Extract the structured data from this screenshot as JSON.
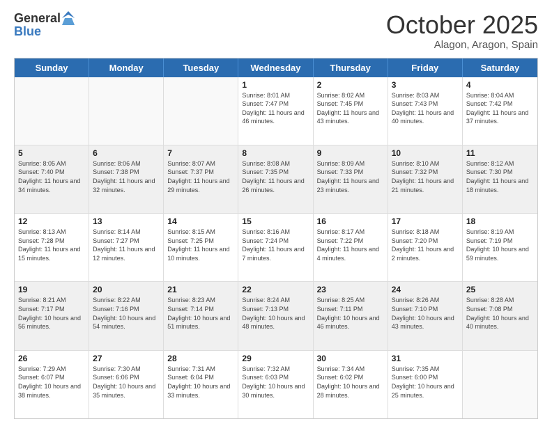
{
  "logo": {
    "general": "General",
    "blue": "Blue"
  },
  "title": "October 2025",
  "subtitle": "Alagon, Aragon, Spain",
  "days": [
    "Sunday",
    "Monday",
    "Tuesday",
    "Wednesday",
    "Thursday",
    "Friday",
    "Saturday"
  ],
  "weeks": [
    [
      {
        "day": "",
        "empty": true
      },
      {
        "day": "",
        "empty": true
      },
      {
        "day": "",
        "empty": true
      },
      {
        "day": "1",
        "rise": "8:01 AM",
        "set": "7:47 PM",
        "daylight": "11 hours and 46 minutes."
      },
      {
        "day": "2",
        "rise": "8:02 AM",
        "set": "7:45 PM",
        "daylight": "11 hours and 43 minutes."
      },
      {
        "day": "3",
        "rise": "8:03 AM",
        "set": "7:43 PM",
        "daylight": "11 hours and 40 minutes."
      },
      {
        "day": "4",
        "rise": "8:04 AM",
        "set": "7:42 PM",
        "daylight": "11 hours and 37 minutes."
      }
    ],
    [
      {
        "day": "5",
        "rise": "8:05 AM",
        "set": "7:40 PM",
        "daylight": "11 hours and 34 minutes."
      },
      {
        "day": "6",
        "rise": "8:06 AM",
        "set": "7:38 PM",
        "daylight": "11 hours and 32 minutes."
      },
      {
        "day": "7",
        "rise": "8:07 AM",
        "set": "7:37 PM",
        "daylight": "11 hours and 29 minutes."
      },
      {
        "day": "8",
        "rise": "8:08 AM",
        "set": "7:35 PM",
        "daylight": "11 hours and 26 minutes."
      },
      {
        "day": "9",
        "rise": "8:09 AM",
        "set": "7:33 PM",
        "daylight": "11 hours and 23 minutes."
      },
      {
        "day": "10",
        "rise": "8:10 AM",
        "set": "7:32 PM",
        "daylight": "11 hours and 21 minutes."
      },
      {
        "day": "11",
        "rise": "8:12 AM",
        "set": "7:30 PM",
        "daylight": "11 hours and 18 minutes."
      }
    ],
    [
      {
        "day": "12",
        "rise": "8:13 AM",
        "set": "7:28 PM",
        "daylight": "11 hours and 15 minutes."
      },
      {
        "day": "13",
        "rise": "8:14 AM",
        "set": "7:27 PM",
        "daylight": "11 hours and 12 minutes."
      },
      {
        "day": "14",
        "rise": "8:15 AM",
        "set": "7:25 PM",
        "daylight": "11 hours and 10 minutes."
      },
      {
        "day": "15",
        "rise": "8:16 AM",
        "set": "7:24 PM",
        "daylight": "11 hours and 7 minutes."
      },
      {
        "day": "16",
        "rise": "8:17 AM",
        "set": "7:22 PM",
        "daylight": "11 hours and 4 minutes."
      },
      {
        "day": "17",
        "rise": "8:18 AM",
        "set": "7:20 PM",
        "daylight": "11 hours and 2 minutes."
      },
      {
        "day": "18",
        "rise": "8:19 AM",
        "set": "7:19 PM",
        "daylight": "10 hours and 59 minutes."
      }
    ],
    [
      {
        "day": "19",
        "rise": "8:21 AM",
        "set": "7:17 PM",
        "daylight": "10 hours and 56 minutes."
      },
      {
        "day": "20",
        "rise": "8:22 AM",
        "set": "7:16 PM",
        "daylight": "10 hours and 54 minutes."
      },
      {
        "day": "21",
        "rise": "8:23 AM",
        "set": "7:14 PM",
        "daylight": "10 hours and 51 minutes."
      },
      {
        "day": "22",
        "rise": "8:24 AM",
        "set": "7:13 PM",
        "daylight": "10 hours and 48 minutes."
      },
      {
        "day": "23",
        "rise": "8:25 AM",
        "set": "7:11 PM",
        "daylight": "10 hours and 46 minutes."
      },
      {
        "day": "24",
        "rise": "8:26 AM",
        "set": "7:10 PM",
        "daylight": "10 hours and 43 minutes."
      },
      {
        "day": "25",
        "rise": "8:28 AM",
        "set": "7:08 PM",
        "daylight": "10 hours and 40 minutes."
      }
    ],
    [
      {
        "day": "26",
        "rise": "7:29 AM",
        "set": "6:07 PM",
        "daylight": "10 hours and 38 minutes."
      },
      {
        "day": "27",
        "rise": "7:30 AM",
        "set": "6:06 PM",
        "daylight": "10 hours and 35 minutes."
      },
      {
        "day": "28",
        "rise": "7:31 AM",
        "set": "6:04 PM",
        "daylight": "10 hours and 33 minutes."
      },
      {
        "day": "29",
        "rise": "7:32 AM",
        "set": "6:03 PM",
        "daylight": "10 hours and 30 minutes."
      },
      {
        "day": "30",
        "rise": "7:34 AM",
        "set": "6:02 PM",
        "daylight": "10 hours and 28 minutes."
      },
      {
        "day": "31",
        "rise": "7:35 AM",
        "set": "6:00 PM",
        "daylight": "10 hours and 25 minutes."
      },
      {
        "day": "",
        "empty": true
      }
    ]
  ]
}
